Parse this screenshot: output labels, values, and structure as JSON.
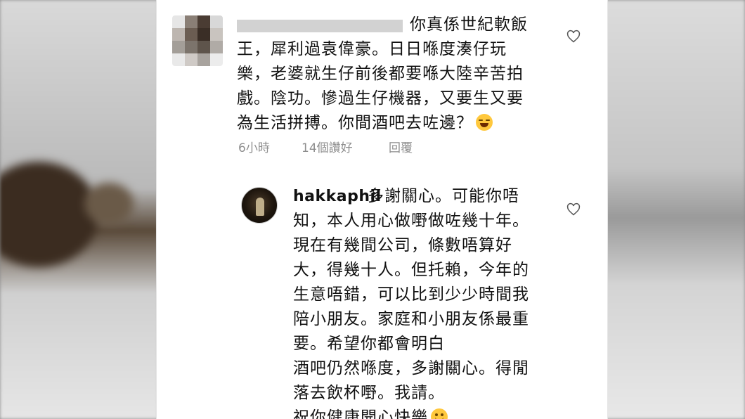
{
  "comment": {
    "text_first_line": "你真係世紀軟飯",
    "text_rest": "王，犀利過袁偉豪。日日喺度湊仔玩\n樂，老婆就生仔前後都要喺大陸辛苦拍\n戲。陰功。慘過生仔機器，又要生又要\n為生活拼搏。你間酒吧去咗邊？",
    "emoji": "laughing-face",
    "time": "6小時",
    "likes": "14個讚好",
    "reply_label": "回覆"
  },
  "reply": {
    "username": "hakkaphil",
    "text_first_line": "多謝關心。可能你唔",
    "text_rest": "知，本人用心做嘢做咗幾十年。\n現在有幾間公司，條數唔算好\n大，得幾十人。但托賴，今年的\n生意唔錯，可以比到少少時間我\n陪小朋友。家庭和小朋友係最重\n要。希望你都會明白\n酒吧仍然喺度，多謝關心。得閒\n落去飲杯嘢。我請。\n祝你健康開心快樂",
    "emoji": "smiling-face"
  },
  "colors": {
    "text": "#111111",
    "meta": "#8e8e8e",
    "heart_stroke": "#555555"
  }
}
